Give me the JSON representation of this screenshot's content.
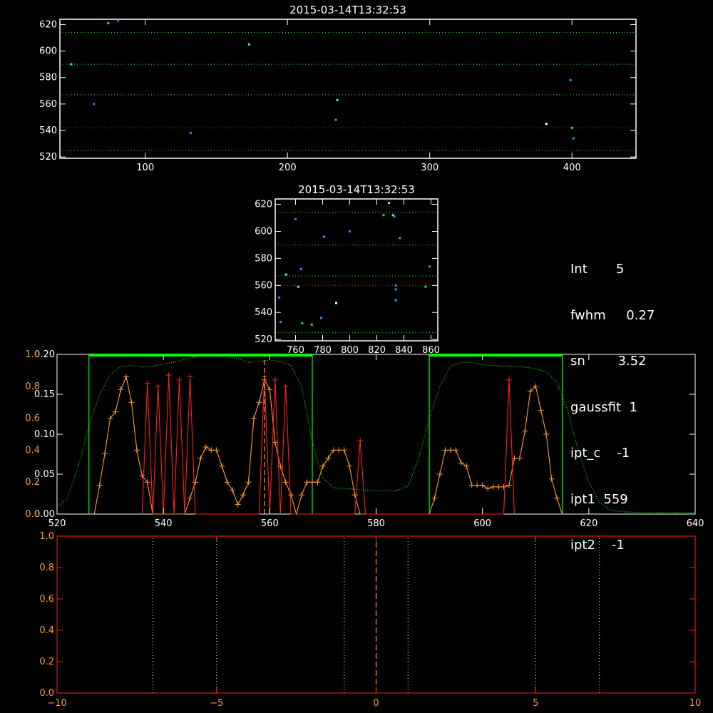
{
  "colors": {
    "background": "#000000",
    "axes": "#ffffff",
    "red": "#ff2020",
    "orange": "#ff9933",
    "green": "#00ff00",
    "blue": "#3399ff",
    "cyan": "#33ffcc",
    "magenta": "#cc33ff"
  },
  "info_lines": [
    "Int       5",
    "fwhm     0.27",
    "sn        3.52",
    "gaussfit  1",
    "ipt_c    -1",
    "ipt1  559",
    "ipt2    -1"
  ],
  "chart_data": [
    {
      "type": "scatter",
      "title": "2015-03-14T13:32:53",
      "xlim": [
        40,
        445
      ],
      "ylim": [
        519,
        624
      ],
      "xticks": [
        100,
        200,
        300,
        400
      ],
      "yticks": [
        520,
        540,
        560,
        580,
        600,
        620
      ],
      "hlines": [
        {
          "y": 614,
          "color": "green"
        },
        {
          "y": 590,
          "color": "green"
        },
        {
          "y": 567,
          "color": "green"
        },
        {
          "y": 542,
          "color": "red"
        },
        {
          "y": 525,
          "color": "green"
        }
      ],
      "points": [
        {
          "x": 48,
          "y": 590,
          "color": "cyan"
        },
        {
          "x": 64,
          "y": 560,
          "color": "magenta"
        },
        {
          "x": 74,
          "y": 621,
          "color": "green"
        },
        {
          "x": 81,
          "y": 623,
          "color": "magenta"
        },
        {
          "x": 132,
          "y": 538,
          "color": "magenta"
        },
        {
          "x": 173,
          "y": 605,
          "color": "cyan"
        },
        {
          "x": 234,
          "y": 548,
          "color": "blue"
        },
        {
          "x": 235,
          "y": 563,
          "color": "cyan"
        },
        {
          "x": 382,
          "y": 545,
          "color": "white"
        },
        {
          "x": 399,
          "y": 578,
          "color": "blue"
        },
        {
          "x": 400,
          "y": 542,
          "color": "green"
        },
        {
          "x": 401,
          "y": 534,
          "color": "blue"
        }
      ]
    },
    {
      "type": "scatter",
      "title": "2015-03-14T13:32:53",
      "xlim": [
        745,
        865
      ],
      "ylim": [
        519,
        624
      ],
      "xticks": [
        760,
        780,
        800,
        820,
        840,
        860
      ],
      "yticks": [
        520,
        540,
        560,
        580,
        600,
        620
      ],
      "hlines": [
        {
          "y": 614,
          "color": "green"
        },
        {
          "y": 590,
          "color": "green"
        },
        {
          "y": 567,
          "color": "green"
        },
        {
          "y": 560,
          "color": "red"
        },
        {
          "y": 525,
          "color": "green"
        }
      ],
      "points": [
        {
          "x": 748,
          "y": 551,
          "color": "magenta"
        },
        {
          "x": 749,
          "y": 533,
          "color": "blue"
        },
        {
          "x": 753,
          "y": 568,
          "color": "cyan"
        },
        {
          "x": 760,
          "y": 609,
          "color": "magenta"
        },
        {
          "x": 762,
          "y": 559,
          "color": "cyan"
        },
        {
          "x": 764,
          "y": 572,
          "color": "blue"
        },
        {
          "x": 765,
          "y": 532,
          "color": "green"
        },
        {
          "x": 772,
          "y": 531,
          "color": "green"
        },
        {
          "x": 779,
          "y": 536,
          "color": "blue"
        },
        {
          "x": 781,
          "y": 596,
          "color": "blue"
        },
        {
          "x": 790,
          "y": 547,
          "color": "white"
        },
        {
          "x": 800,
          "y": 600,
          "color": "magenta"
        },
        {
          "x": 825,
          "y": 612,
          "color": "green"
        },
        {
          "x": 829,
          "y": 621,
          "color": "cyan"
        },
        {
          "x": 832,
          "y": 612,
          "color": "cyan"
        },
        {
          "x": 833,
          "y": 611,
          "color": "blue"
        },
        {
          "x": 834,
          "y": 560,
          "color": "blue"
        },
        {
          "x": 834,
          "y": 557,
          "color": "blue"
        },
        {
          "x": 834,
          "y": 549,
          "color": "blue"
        },
        {
          "x": 837,
          "y": 595,
          "color": "blue"
        },
        {
          "x": 856,
          "y": 559,
          "color": "green"
        },
        {
          "x": 859,
          "y": 574,
          "color": "blue"
        }
      ]
    },
    {
      "type": "line",
      "xlim": [
        520,
        640
      ],
      "xticks": [
        520,
        540,
        560,
        580,
        600,
        620,
        640
      ],
      "ylim_left": [
        0,
        0.2
      ],
      "yticks_left": [
        "0.00",
        "0.05",
        "0.10",
        "0.15",
        "0.20"
      ],
      "yticks_left_values": [
        0,
        0.05,
        0.1,
        0.15,
        0.2
      ],
      "yticks_red": [
        "0.0",
        "0.2",
        "0.4",
        "0.6",
        "0.8",
        "1.0"
      ],
      "yticks_red_values": [
        0,
        0.2,
        0.4,
        0.6,
        0.8,
        1.0
      ],
      "windows": [
        [
          526,
          568
        ],
        [
          590,
          615
        ]
      ],
      "vline_dashed": 559,
      "series": [
        {
          "color": "green",
          "style": "dotted",
          "scale": "left",
          "x": [
            520,
            522,
            524,
            526,
            528,
            530,
            532,
            534,
            536,
            538,
            540,
            542,
            544,
            546,
            548,
            550,
            552,
            554,
            556,
            558,
            560,
            562,
            564,
            566,
            568,
            570,
            572,
            574,
            576,
            578,
            580,
            582,
            584,
            586,
            588,
            590,
            592,
            594,
            596,
            598,
            600,
            602,
            604,
            606,
            608,
            610,
            612,
            614,
            616,
            618,
            620,
            622,
            624,
            626,
            630,
            635,
            640
          ],
          "values": [
            0.008,
            0.02,
            0.06,
            0.11,
            0.15,
            0.175,
            0.185,
            0.186,
            0.184,
            0.185,
            0.188,
            0.19,
            0.194,
            0.197,
            0.199,
            0.2,
            0.197,
            0.195,
            0.19,
            0.191,
            0.193,
            0.191,
            0.186,
            0.16,
            0.09,
            0.045,
            0.033,
            0.032,
            0.031,
            0.03,
            0.029,
            0.029,
            0.03,
            0.035,
            0.07,
            0.12,
            0.16,
            0.185,
            0.19,
            0.19,
            0.187,
            0.186,
            0.185,
            0.185,
            0.184,
            0.182,
            0.178,
            0.165,
            0.13,
            0.08,
            0.04,
            0.015,
            0.005,
            0.003,
            0.002,
            0.002,
            0.002
          ]
        },
        {
          "color": "orange",
          "style": "plus",
          "scale": "red",
          "x": [
            527,
            528,
            529,
            530,
            531,
            532,
            533,
            534,
            535,
            536,
            537,
            538,
            539,
            540,
            541,
            542,
            543,
            544,
            545,
            546,
            547,
            548,
            549,
            550,
            551,
            552,
            553,
            554,
            555,
            556,
            557,
            558,
            559,
            560,
            561,
            562,
            563,
            564,
            565,
            566,
            567,
            568,
            569,
            570,
            571,
            572,
            573,
            574,
            575,
            576,
            577,
            578,
            579,
            580,
            581,
            582,
            583,
            584,
            585,
            586,
            587,
            588,
            589,
            590,
            591,
            592,
            593,
            594,
            595,
            596,
            597,
            598,
            599,
            600,
            601,
            602,
            603,
            604,
            605,
            606,
            607,
            608,
            609,
            610,
            611,
            612,
            613,
            614,
            615
          ],
          "values": [
            0,
            0.18,
            0.38,
            0.6,
            0.64,
            0.78,
            0.86,
            0.7,
            0.4,
            0.24,
            0.2,
            0.0,
            0.0,
            0.0,
            0.0,
            0.0,
            0.0,
            0.0,
            0.1,
            0.2,
            0.35,
            0.42,
            0.4,
            0.4,
            0.3,
            0.2,
            0.15,
            0.06,
            0.12,
            0.2,
            0.6,
            0.7,
            0.84,
            0.78,
            0.45,
            0.3,
            0.2,
            0.12,
            0.0,
            0.12,
            0.2,
            0.2,
            0.2,
            0.3,
            0.35,
            0.4,
            0.4,
            0.4,
            0.3,
            0.12,
            0.0,
            0.0,
            0.0,
            0.0,
            0.0,
            0.0,
            0.0,
            0.0,
            0.0,
            0.0,
            0.0,
            0.0,
            0.0,
            0.0,
            0.1,
            0.25,
            0.4,
            0.4,
            0.4,
            0.32,
            0.3,
            0.18,
            0.18,
            0.18,
            0.16,
            0.17,
            0.17,
            0.17,
            0.18,
            0.35,
            0.35,
            0.52,
            0.77,
            0.8,
            0.65,
            0.5,
            0.22,
            0.1,
            0.0
          ]
        },
        {
          "color": "red",
          "style": "plus",
          "scale": "red",
          "x": [
            536,
            537,
            538,
            539,
            540,
            541,
            542,
            543,
            544,
            545,
            546,
            547,
            558,
            559,
            560,
            561,
            562,
            563,
            564,
            565,
            576,
            577,
            578,
            600,
            601,
            602,
            603,
            604,
            605,
            606
          ],
          "values": [
            0.0,
            0.82,
            0.0,
            0.8,
            0.0,
            0.87,
            0.0,
            0.84,
            0.0,
            0.86,
            0.0,
            0.0,
            0.0,
            0.86,
            0.0,
            0.84,
            0.0,
            0.8,
            0.0,
            0.0,
            0.0,
            0.46,
            0.0,
            0.0,
            0.0,
            0.0,
            0.0,
            0.0,
            0.84,
            0.0
          ]
        }
      ]
    },
    {
      "type": "line",
      "xlim": [
        -10,
        10
      ],
      "ylim": [
        0,
        1.0
      ],
      "xticks": [
        -10,
        -5,
        0,
        5,
        10
      ],
      "yticks": [
        "0.0",
        "0.2",
        "0.4",
        "0.6",
        "0.8",
        "1.0"
      ],
      "yticks_values": [
        0,
        0.2,
        0.4,
        0.6,
        0.8,
        1.0
      ],
      "vlines_dotted": [
        -7,
        -5,
        -1,
        1,
        5,
        7
      ],
      "vline_dashed": 0
    }
  ]
}
